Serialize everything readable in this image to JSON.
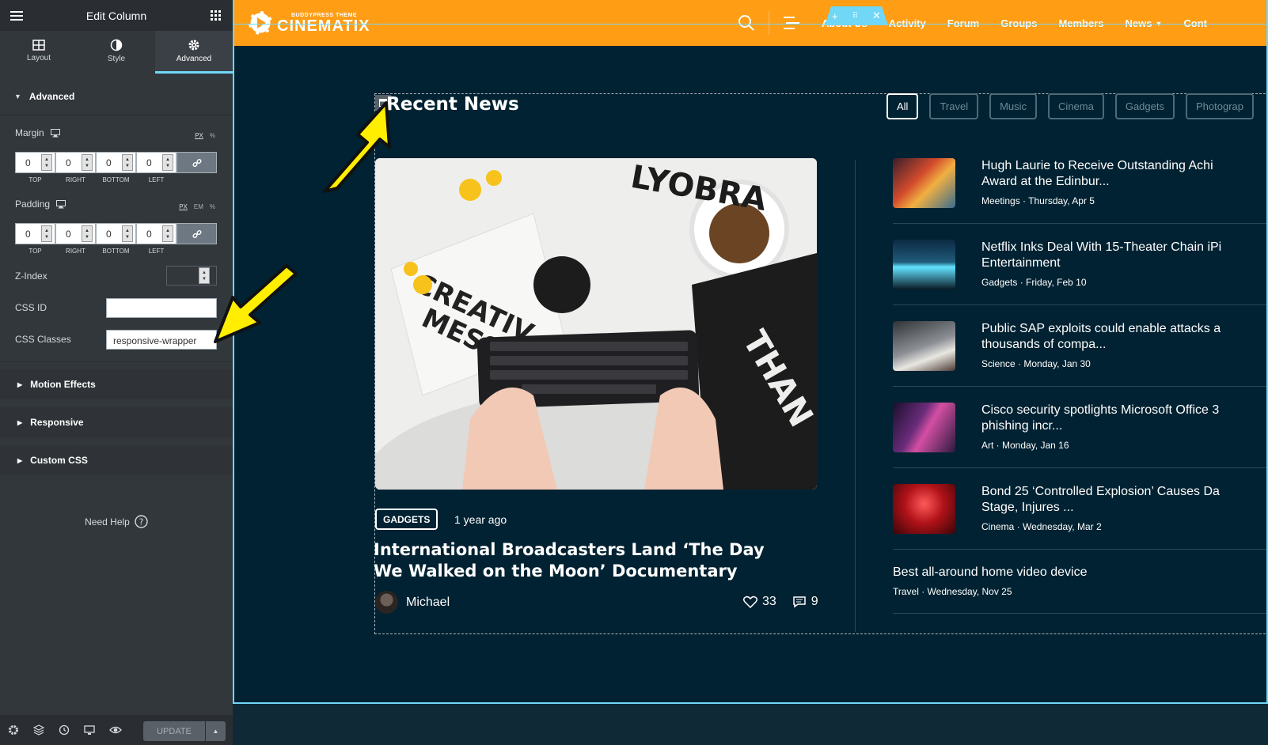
{
  "panel": {
    "title": "Edit Column",
    "tabs": [
      {
        "label": "Layout"
      },
      {
        "label": "Style"
      },
      {
        "label": "Advanced"
      }
    ],
    "advanced_section": "Advanced",
    "margin": {
      "label": "Margin",
      "units": [
        "PX",
        "%"
      ],
      "values": [
        "0",
        "0",
        "0",
        "0"
      ],
      "sides": [
        "TOP",
        "RIGHT",
        "BOTTOM",
        "LEFT"
      ]
    },
    "padding": {
      "label": "Padding",
      "units": [
        "PX",
        "EM",
        "%"
      ],
      "values": [
        "0",
        "0",
        "0",
        "0"
      ],
      "sides": [
        "TOP",
        "RIGHT",
        "BOTTOM",
        "LEFT"
      ]
    },
    "z_index_label": "Z-Index",
    "css_id_label": "CSS ID",
    "css_id_value": "",
    "css_classes_label": "CSS Classes",
    "css_classes_value": "responsive-wrapper",
    "collapsed_sections": [
      "Motion Effects",
      "Responsive",
      "Custom CSS"
    ],
    "need_help": "Need Help",
    "update_label": "UPDATE"
  },
  "site": {
    "logo_tagline": "BUDDYPRESS THEME",
    "logo_brand": "CINEMATIX",
    "nav": [
      "About Us",
      "Activity",
      "Forum",
      "Groups",
      "Members",
      "News",
      "Cont"
    ],
    "section_title": "Recent News",
    "filters": [
      "All",
      "Travel",
      "Music",
      "Cinema",
      "Gadgets",
      "Photograp"
    ],
    "featured": {
      "category": "GADGETS",
      "date": "1 year ago",
      "title": "International Broadcasters Land ‘The Day We Walked on the Moon’ Documentary",
      "author": "Michael",
      "likes": "33",
      "comments": "9"
    },
    "news": [
      {
        "title": "Hugh Laurie to Receive Outstanding Achi",
        "title2": "Award at the Edinbur...",
        "meta": "Meetings · Thursday, Apr 5"
      },
      {
        "title": "Netflix Inks Deal With 15-Theater Chain iPi",
        "title2": "Entertainment",
        "meta": "Gadgets · Friday, Feb 10"
      },
      {
        "title": "Public SAP exploits could enable attacks a",
        "title2": "thousands of compa...",
        "meta": "Science · Monday, Jan 30"
      },
      {
        "title": "Cisco security spotlights Microsoft Office 3",
        "title2": "phishing incr...",
        "meta": "Art · Monday, Jan 16"
      },
      {
        "title": "Bond 25 ‘Controlled Explosion’ Causes Da",
        "title2": "Stage, Injures ...",
        "meta": "Cinema · Wednesday, Mar 2"
      }
    ],
    "last_news": {
      "title": "Best all-around home video device",
      "meta": "Travel · Wednesday, Nov 25"
    }
  },
  "colors": {
    "topbar": "#ff9d14",
    "editor_accent": "#71d7f7",
    "page_bg": "#012232",
    "annotation_arrow": "#ffee00"
  }
}
